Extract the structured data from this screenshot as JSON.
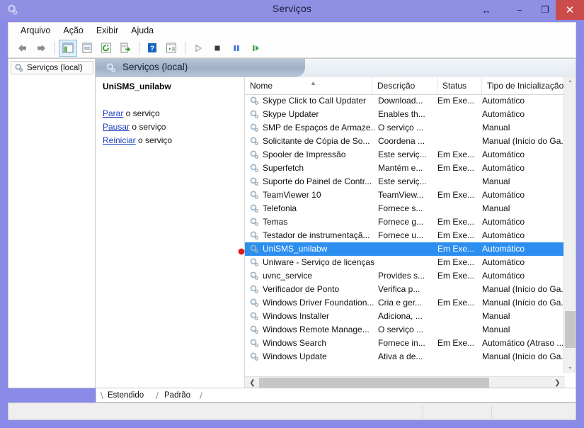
{
  "window": {
    "title": "Serviços",
    "accent_color": "#8f8fe4",
    "close_color": "#cc4b4b",
    "selection_color": "#2c8ff0"
  },
  "titlebar_buttons": {
    "resize": "↔",
    "minimize": "−",
    "maximize": "❐",
    "close": "✕"
  },
  "menu": {
    "items": [
      "Arquivo",
      "Ação",
      "Exibir",
      "Ajuda"
    ]
  },
  "toolbar": {
    "buttons": [
      {
        "name": "back",
        "glyph": "⬅"
      },
      {
        "name": "forward",
        "glyph": "➡"
      },
      {
        "name": "show-hide-console-tree",
        "glyph": "▤"
      },
      {
        "name": "properties",
        "glyph": "▤"
      },
      {
        "name": "refresh",
        "glyph": "⟳"
      },
      {
        "name": "export-list",
        "glyph": "⇥"
      },
      {
        "name": "help",
        "glyph": "?"
      },
      {
        "name": "show-hide-action-pane",
        "glyph": "▥"
      },
      {
        "name": "start-service",
        "glyph": "▶"
      },
      {
        "name": "stop-service",
        "glyph": "■"
      },
      {
        "name": "pause-service",
        "glyph": "❚❚"
      },
      {
        "name": "restart-service",
        "glyph": "❚▶"
      }
    ]
  },
  "tree": {
    "root_label": "Serviços (local)"
  },
  "banner": {
    "title": "Serviços (local)"
  },
  "detail": {
    "service_name": "UniSMS_unilabw",
    "links": [
      {
        "link": "Parar",
        "rest": " o serviço"
      },
      {
        "link": "Pausar",
        "rest": " o serviço"
      },
      {
        "link": "Reiniciar",
        "rest": " o serviço"
      }
    ]
  },
  "list": {
    "columns": [
      "Nome",
      "Descrição",
      "Status",
      "Tipo de Inicialização"
    ],
    "sort_column": "Nome",
    "sort_direction": "ascending",
    "rows": [
      {
        "name": "Skype Click to Call Updater",
        "desc": "Download...",
        "status": "Em Exe...",
        "type": "Automático",
        "selected": false
      },
      {
        "name": "Skype Updater",
        "desc": "Enables th...",
        "status": "",
        "type": "Automático",
        "selected": false
      },
      {
        "name": "SMP de Espaços de Armaze...",
        "desc": "O serviço ...",
        "status": "",
        "type": "Manual",
        "selected": false
      },
      {
        "name": "Solicitante de Cópia de So...",
        "desc": "Coordena ...",
        "status": "",
        "type": "Manual (Início do Ga...",
        "selected": false
      },
      {
        "name": "Spooler de Impressão",
        "desc": "Este serviç...",
        "status": "Em Exe...",
        "type": "Automático",
        "selected": false
      },
      {
        "name": "Superfetch",
        "desc": "Mantém e...",
        "status": "Em Exe...",
        "type": "Automático",
        "selected": false
      },
      {
        "name": "Suporte do Painel de Contr...",
        "desc": "Este serviç...",
        "status": "",
        "type": "Manual",
        "selected": false
      },
      {
        "name": "TeamViewer 10",
        "desc": "TeamView...",
        "status": "Em Exe...",
        "type": "Automático",
        "selected": false
      },
      {
        "name": "Telefonia",
        "desc": "Fornece s...",
        "status": "",
        "type": "Manual",
        "selected": false
      },
      {
        "name": "Temas",
        "desc": "Fornece g...",
        "status": "Em Exe...",
        "type": "Automático",
        "selected": false
      },
      {
        "name": "Testador de instrumentaçã...",
        "desc": "Fornece u...",
        "status": "Em Exe...",
        "type": "Automático",
        "selected": false
      },
      {
        "name": "UniSMS_unilabw",
        "desc": "",
        "status": "Em Exe...",
        "type": "Automático",
        "selected": true
      },
      {
        "name": "Uniware - Serviço de licenças",
        "desc": "",
        "status": "Em Exe...",
        "type": "Automático",
        "selected": false
      },
      {
        "name": "uvnc_service",
        "desc": "Provides s...",
        "status": "Em Exe...",
        "type": "Automático",
        "selected": false
      },
      {
        "name": "Verificador de Ponto",
        "desc": "Verifica p...",
        "status": "",
        "type": "Manual (Início do Ga...",
        "selected": false
      },
      {
        "name": "Windows Driver Foundation...",
        "desc": "Cria e ger...",
        "status": "Em Exe...",
        "type": "Manual (Início do Ga...",
        "selected": false
      },
      {
        "name": "Windows Installer",
        "desc": "Adiciona, ...",
        "status": "",
        "type": "Manual",
        "selected": false
      },
      {
        "name": "Windows Remote Manage...",
        "desc": "O serviço ...",
        "status": "",
        "type": "Manual",
        "selected": false
      },
      {
        "name": "Windows Search",
        "desc": "Fornece in...",
        "status": "Em Exe...",
        "type": "Automático (Atraso ...",
        "selected": false
      },
      {
        "name": "Windows Update",
        "desc": "Ativa a de...",
        "status": "",
        "type": "Manual (Início do Ga...",
        "selected": false
      }
    ]
  },
  "scrollbars": {
    "vertical_up": "⌃",
    "vertical_down": "⌄",
    "horizontal_left": "❮",
    "horizontal_right": "❯"
  },
  "tabs": [
    {
      "label": "Estendido",
      "active": false
    },
    {
      "label": "Padrão",
      "active": true
    }
  ],
  "statusbar": {
    "text": ""
  }
}
